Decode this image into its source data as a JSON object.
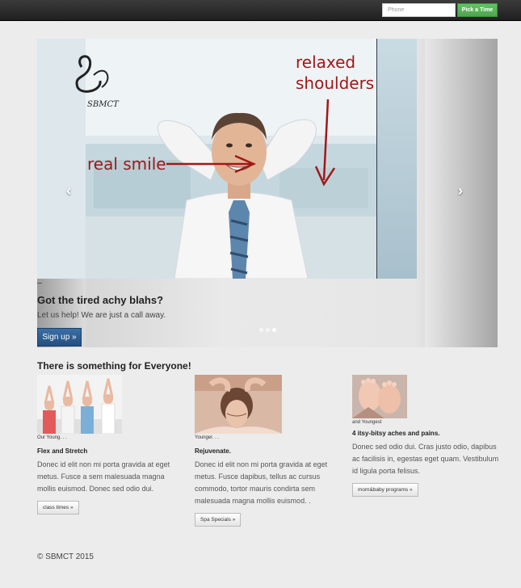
{
  "navbar": {
    "phone_placeholder": "Phone",
    "pick_time_label": "Pick a Time",
    "pick_time_color": "#5bb75b"
  },
  "carousel": {
    "logo_text": "SBMCT",
    "annotation_top_line1": "relaxed",
    "annotation_top_line2": "shoulders",
    "annotation_left": "real smile",
    "heading": "Got the tired achy blahs?",
    "text": "Let us help! We are just a call away.",
    "button_label": "Sign up »",
    "prev_arrow": "‹",
    "next_arrow": "›",
    "active_indicator": 3,
    "indicator_count": 3
  },
  "section": {
    "heading": "There is something for Everyone!",
    "columns": [
      {
        "caption": "Our Young. . .",
        "title": "Flex and Stretch",
        "body": "Donec id elit non mi porta gravida at eget metus. Fusce a sem malesuada magna mollis euismod. Donec sed odio dui.",
        "button_label": "class times »"
      },
      {
        "caption": "Younger. . .",
        "title": "Rejuvenate.",
        "body": "Donec id elit non mi porta gravida at eget metus. Fusce dapibus, tellus ac cursus commodo, tortor mauris condirta sem malesuada magna mollis euismod. .",
        "button_label": "Spa Specials »"
      },
      {
        "caption": "and Youngest",
        "title": "4 itsy-bitsy aches and pains.",
        "body": "Donec sed odio dui. Cras justo odio, dapibus ac facilisis in, egestas eget quam. Vestibulum id ligula porta felisus.",
        "button_label": "mom&baby programs »"
      }
    ]
  },
  "footer": {
    "text": "© SBMCT 2015"
  }
}
